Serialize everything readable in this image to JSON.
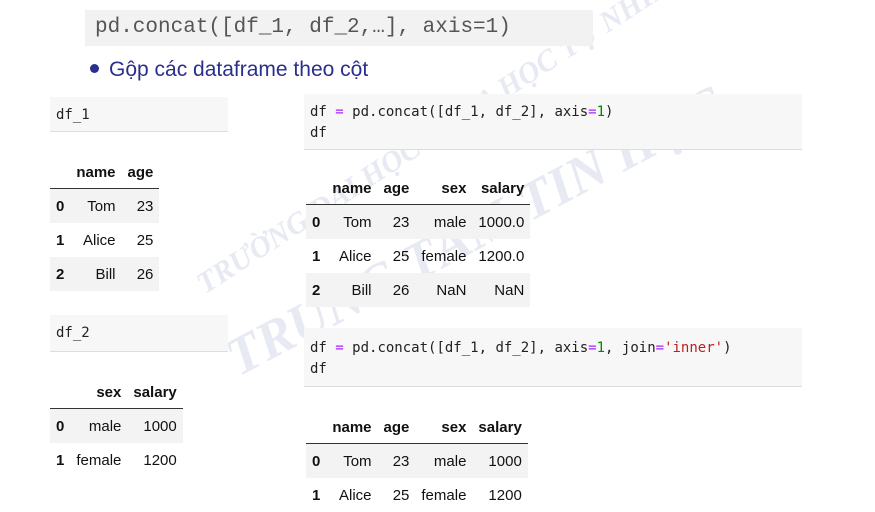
{
  "header_code": "pd.concat([df_1, df_2,…], axis=1)",
  "bullet": "Gộp các dataframe theo cột",
  "watermark": {
    "line1": "TRƯỜNG ĐẠI HỌC KHOA HỌC TỰ NHIÊN",
    "line2": "TRUNG TÂM TIN HỌC"
  },
  "df1": {
    "label": "df_1",
    "columns": [
      "name",
      "age"
    ],
    "rows": [
      [
        "0",
        "Tom",
        "23"
      ],
      [
        "1",
        "Alice",
        "25"
      ],
      [
        "2",
        "Bill",
        "26"
      ]
    ]
  },
  "df2": {
    "label": "df_2",
    "columns": [
      "sex",
      "salary"
    ],
    "rows": [
      [
        "0",
        "male",
        "1000"
      ],
      [
        "1",
        "female",
        "1200"
      ]
    ]
  },
  "outer": {
    "code": {
      "a": "df ",
      "eq": "=",
      "b": " pd.concat([df_1, df_2], axis",
      "eq2": "=",
      "one": "1",
      "c": ")",
      "line2": "df"
    },
    "columns": [
      "name",
      "age",
      "sex",
      "salary"
    ],
    "rows": [
      [
        "0",
        "Tom",
        "23",
        "male",
        "1000.0"
      ],
      [
        "1",
        "Alice",
        "25",
        "female",
        "1200.0"
      ],
      [
        "2",
        "Bill",
        "26",
        "NaN",
        "NaN"
      ]
    ]
  },
  "inner": {
    "code": {
      "a": "df ",
      "eq": "=",
      "b": " pd.concat([df_1, df_2], axis",
      "eq2": "=",
      "one": "1",
      "c": ", join",
      "eq3": "=",
      "s": "'inner'",
      "d": ")",
      "line2": "df"
    },
    "columns": [
      "name",
      "age",
      "sex",
      "salary"
    ],
    "rows": [
      [
        "0",
        "Tom",
        "23",
        "male",
        "1000"
      ],
      [
        "1",
        "Alice",
        "25",
        "female",
        "1200"
      ]
    ]
  }
}
